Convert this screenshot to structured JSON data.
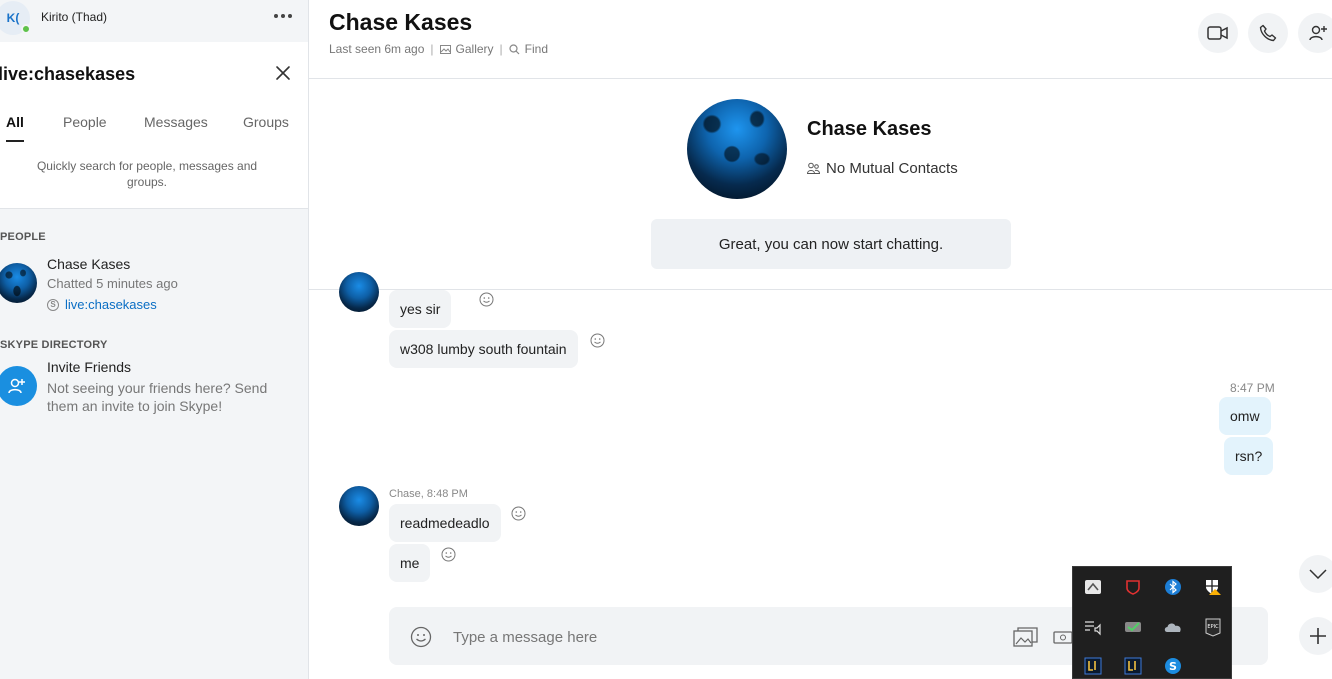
{
  "profile": {
    "initials": "K(",
    "name": "Kirito (Thad)"
  },
  "search": {
    "query": "live:chasekases",
    "hint": "Quickly search for people, messages and groups."
  },
  "tabs": [
    {
      "label": "All",
      "active": true
    },
    {
      "label": "People",
      "active": false
    },
    {
      "label": "Messages",
      "active": false
    },
    {
      "label": "Groups",
      "active": false
    }
  ],
  "sections": {
    "people": "PEOPLE",
    "directory": "SKYPE DIRECTORY"
  },
  "people_results": [
    {
      "name": "Chase Kases",
      "subtitle": "Chatted 5 minutes ago",
      "skype_id": "live:chasekases"
    }
  ],
  "invite": {
    "title": "Invite Friends",
    "text": "Not seeing your friends here? Send them an invite to join Skype!"
  },
  "chat": {
    "title": "Chase Kases",
    "last_seen": "Last seen 6m ago",
    "gallery": "Gallery",
    "find": "Find",
    "intro_name": "Chase Kases",
    "mutual": "No Mutual Contacts",
    "banner": "Great, you can now start chatting."
  },
  "messages": [
    {
      "from": "them",
      "text": "yes sir"
    },
    {
      "from": "them",
      "text": "w308 lumby south fountain"
    },
    {
      "from": "me",
      "time": "8:47 PM",
      "text": "omw"
    },
    {
      "from": "me",
      "text": "rsn?"
    },
    {
      "from": "them",
      "meta": "Chase, 8:48 PM",
      "text": "readmedeadlo"
    },
    {
      "from": "them",
      "text": "me"
    }
  ],
  "composer": {
    "placeholder": "Type a message here"
  },
  "colors": {
    "accent": "#0a6ec4",
    "online": "#5ec24a",
    "bubble_out": "#e3f3fc",
    "bubble_in": "#f1f3f5",
    "tray_bg": "#1f1f1f"
  },
  "tray_icons": [
    "app-icon",
    "antivirus-icon",
    "bluetooth-icon",
    "security-warning-icon",
    "audio-list-icon",
    "sync-check-icon",
    "onedrive-icon",
    "epic-games-icon",
    "game-launcher-icon",
    "game-launcher-icon",
    "skype-icon"
  ]
}
